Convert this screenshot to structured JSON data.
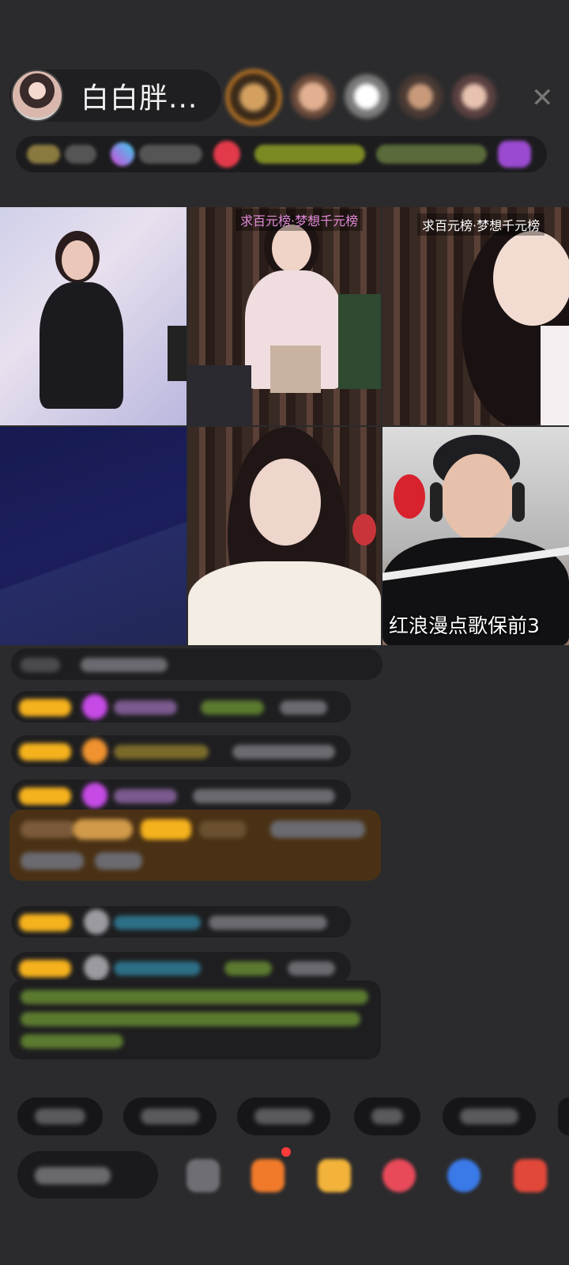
{
  "header": {
    "host_name": "白白胖...",
    "close_icon": "close-icon",
    "viewers": [
      "viewer-1",
      "viewer-2",
      "viewer-3",
      "viewer-4",
      "viewer-5"
    ]
  },
  "grid": {
    "cells": [
      {
        "banner": "",
        "caption": ""
      },
      {
        "banner": "求百元榜·梦想千元榜",
        "caption": ""
      },
      {
        "banner": "求百元榜·梦想千元榜",
        "caption": ""
      },
      {
        "banner": "",
        "caption": ""
      },
      {
        "banner": "",
        "caption": ""
      },
      {
        "banner": "",
        "caption": "红浪漫点歌保前3"
      }
    ]
  },
  "colors": {
    "background": "#2b2b2d",
    "badge_gold": "#f6b21d",
    "accent_orange": "#e08a25",
    "gift_bg": "#4a3115"
  }
}
